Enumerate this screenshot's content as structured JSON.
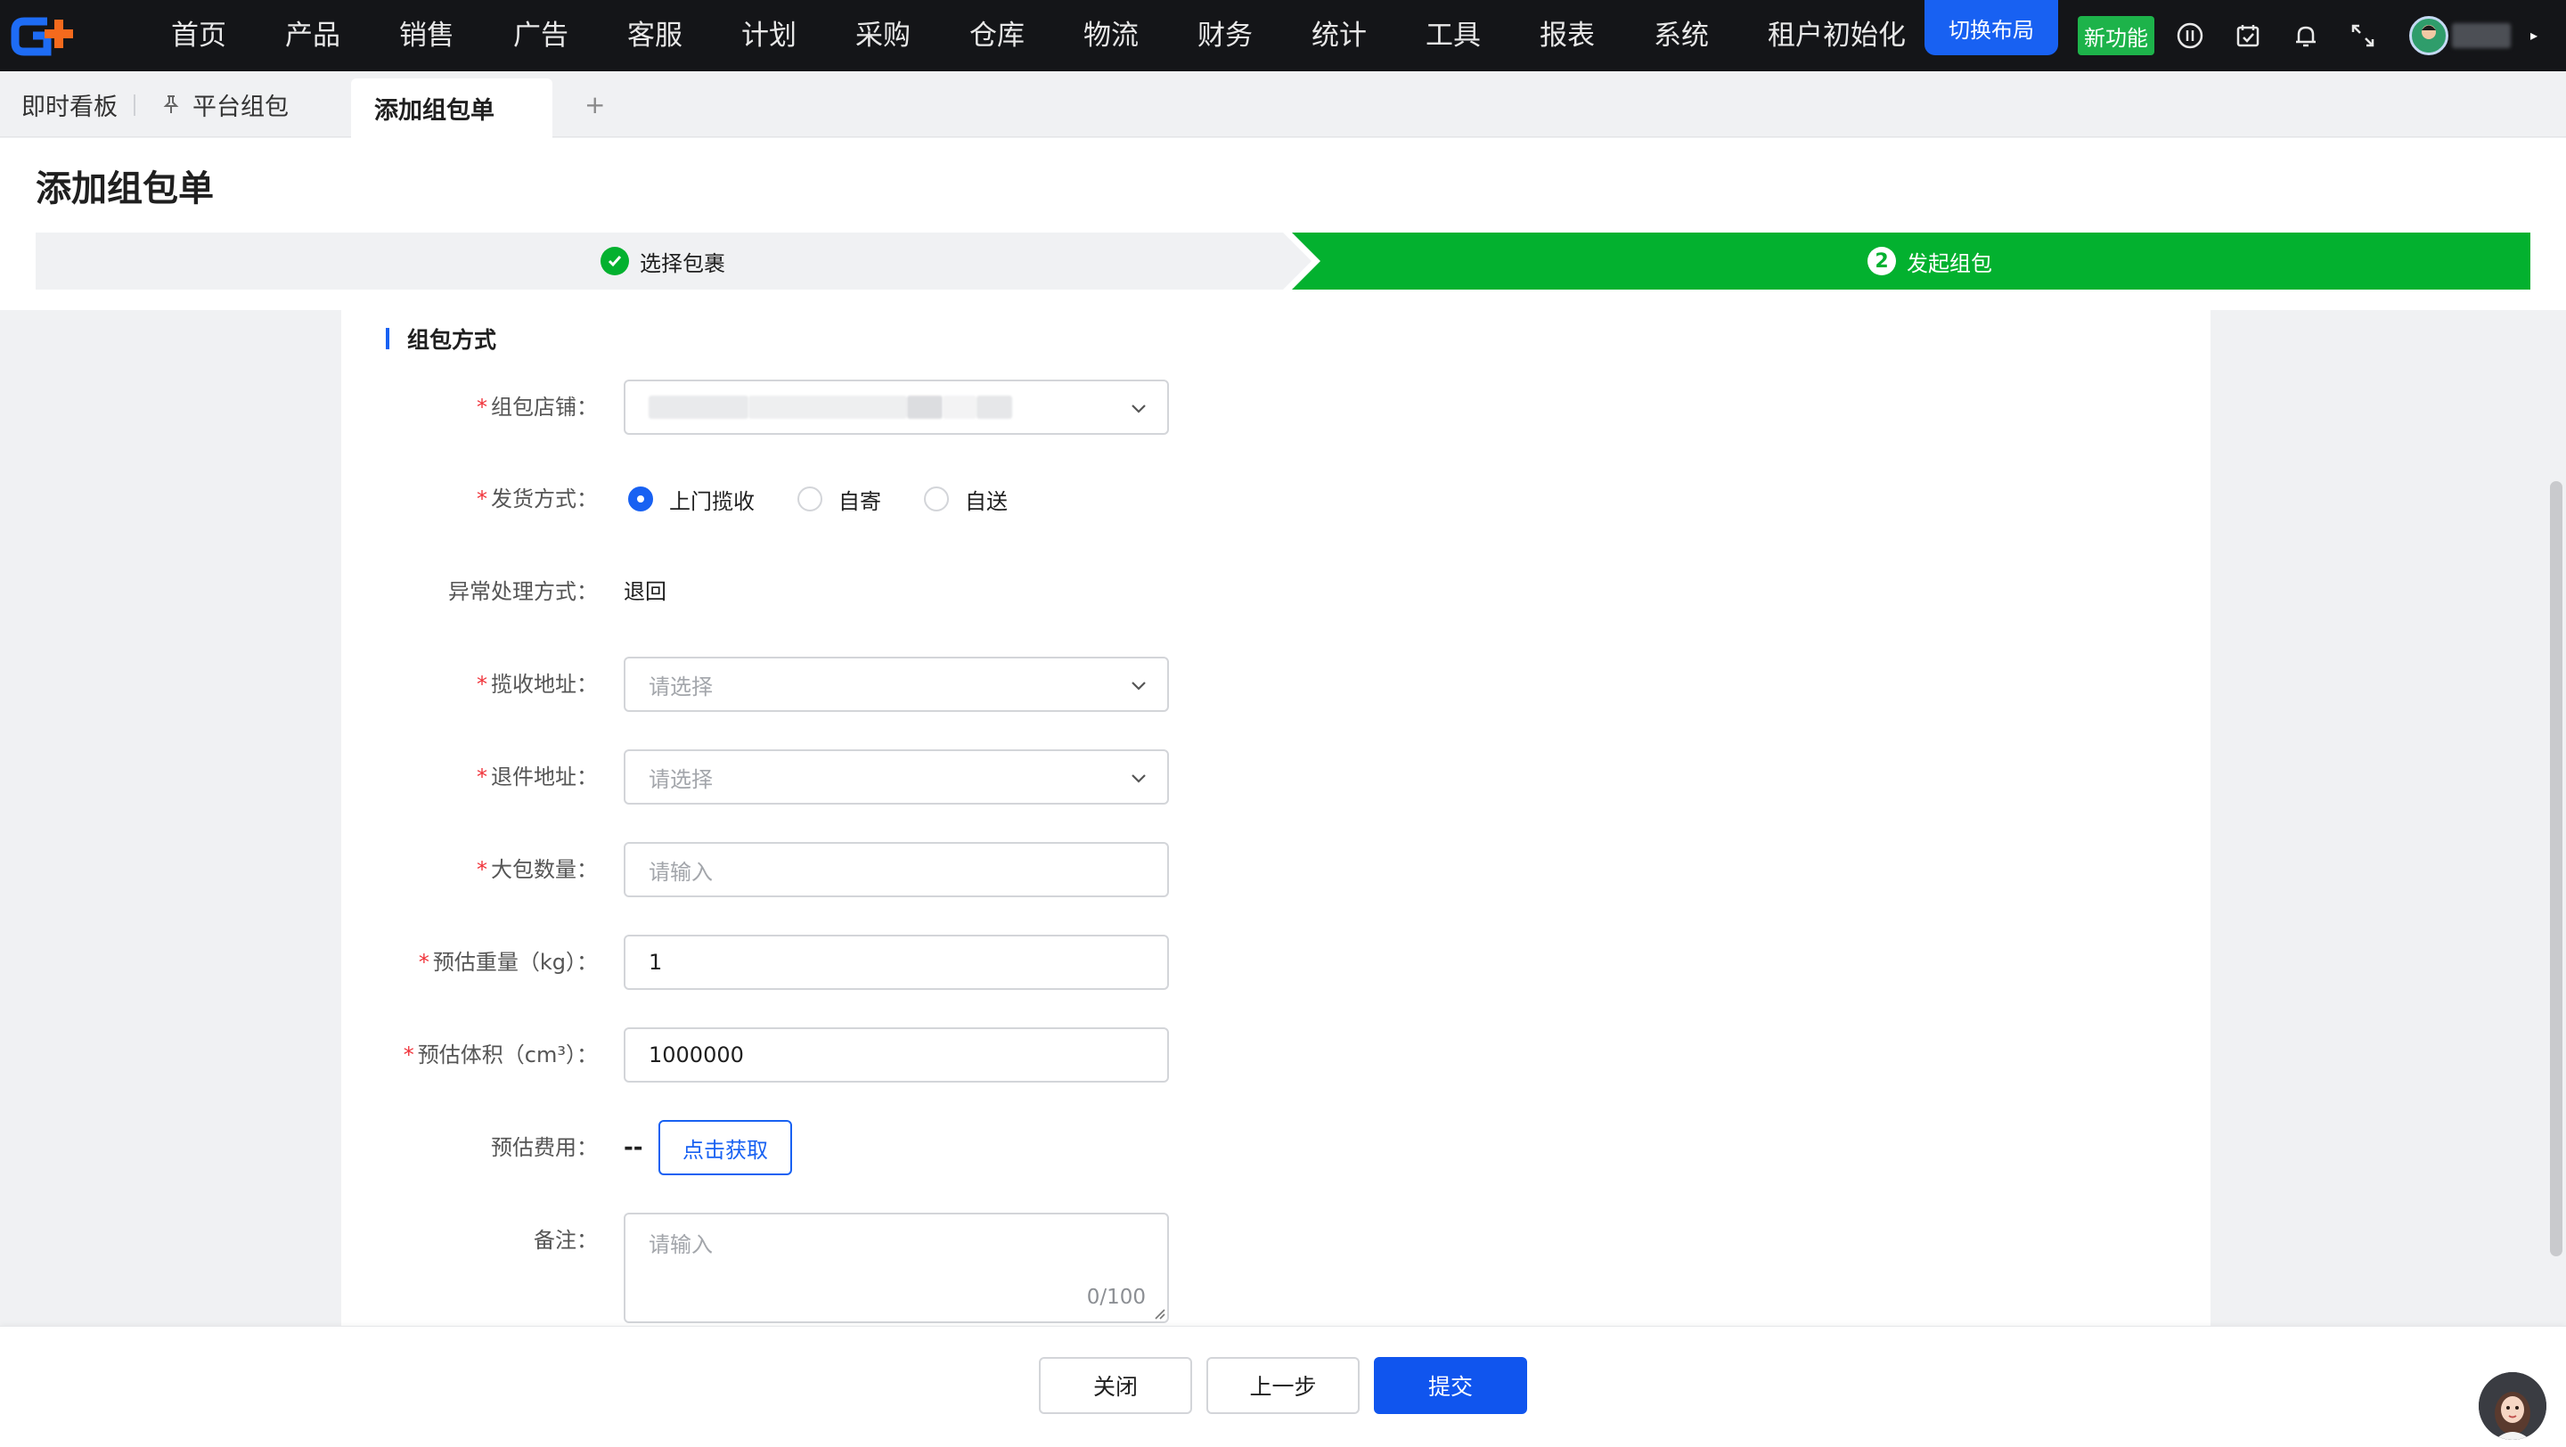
{
  "nav": {
    "items": [
      "首页",
      "产品",
      "销售",
      "广告",
      "客服",
      "计划",
      "采购",
      "仓库",
      "物流",
      "财务",
      "统计",
      "工具",
      "报表",
      "系统",
      "租户初始化"
    ],
    "switch_layout": "切换布局",
    "new_feature": "新功能"
  },
  "tabs": {
    "items": [
      "即时看板",
      "平台组包",
      "添加组包单"
    ],
    "add": "+"
  },
  "page": {
    "title": "添加组包单",
    "steps": [
      {
        "label": "选择包裹",
        "status": "done"
      },
      {
        "label": "发起组包",
        "status": "active",
        "number": "2"
      }
    ]
  },
  "form": {
    "section_title": "组包方式",
    "store": {
      "label": "组包店铺："
    },
    "ship_method": {
      "label": "发货方式：",
      "options": [
        "上门揽收",
        "自寄",
        "自送"
      ],
      "selected": "上门揽收"
    },
    "exception": {
      "label": "异常处理方式：",
      "value": "退回"
    },
    "pickup_address": {
      "label": "揽收地址：",
      "placeholder": "请选择"
    },
    "return_address": {
      "label": "退件地址：",
      "placeholder": "请选择"
    },
    "big_pack_count": {
      "label": "大包数量：",
      "placeholder": "请输入"
    },
    "est_weight": {
      "label": "预估重量（kg）：",
      "value": "1"
    },
    "est_volume": {
      "label": "预估体积（cm³）：",
      "value": "1000000"
    },
    "est_fee": {
      "label": "预估费用：",
      "value": "--",
      "button": "点击获取"
    },
    "remark": {
      "label": "备注：",
      "placeholder": "请输入",
      "counter": "0/100"
    }
  },
  "actions": {
    "close": "关闭",
    "prev": "上一步",
    "submit": "提交"
  },
  "colors": {
    "primary": "#1861f2",
    "step_active": "#03b12f",
    "required": "#f0333a",
    "new_badge": "#1db34a"
  }
}
